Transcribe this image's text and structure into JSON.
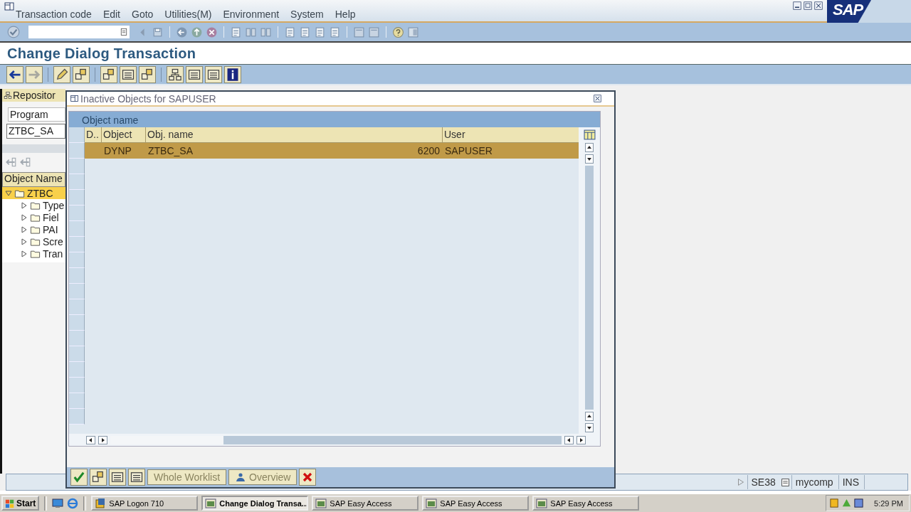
{
  "window": {
    "menu": [
      "Transaction code",
      "Edit",
      "Goto",
      "Utilities(M)",
      "Environment",
      "System",
      "Help"
    ],
    "logo": "SAP"
  },
  "title": "Change Dialog Transaction",
  "left_panel": {
    "tab": "Repositor",
    "dropdown": "Program",
    "field": "ZTBC_SA",
    "tree_header": "Object Name",
    "tree": [
      {
        "label": "ZTBC",
        "expanded": true,
        "selected": true,
        "children": [
          {
            "label": "Type",
            "expanded": false,
            "selected": false
          },
          {
            "label": "Fiel",
            "expanded": false,
            "selected": false
          },
          {
            "label": "PAI",
            "expanded": false,
            "selected": false
          },
          {
            "label": "Scre",
            "expanded": false,
            "selected": false
          },
          {
            "label": "Tran",
            "expanded": false,
            "selected": false
          }
        ]
      }
    ]
  },
  "dialog": {
    "title": "Inactive Objects for SAPUSER",
    "section": "Object name",
    "columns": [
      "D..",
      "Object",
      "Obj. name",
      "User"
    ],
    "rows": [
      {
        "selected": true,
        "object": "DYNP",
        "obj_name": "ZTBC_SA",
        "number": "6200",
        "user": "SAPUSER"
      }
    ],
    "buttons": [
      "Whole Worklist",
      "Overview"
    ]
  },
  "status_bar": {
    "transaction": "SE38",
    "server": "mycomp",
    "mode": "INS"
  },
  "taskbar": {
    "start": "Start",
    "tasks": [
      {
        "label": "SAP Logon 710",
        "selected": false
      },
      {
        "label": "Change Dialog Transa...",
        "selected": true
      },
      {
        "label": "SAP Easy Access",
        "selected": false
      },
      {
        "label": "SAP Easy Access",
        "selected": false
      },
      {
        "label": "SAP Easy Access",
        "selected": false
      }
    ],
    "clock": "5:29 PM"
  }
}
